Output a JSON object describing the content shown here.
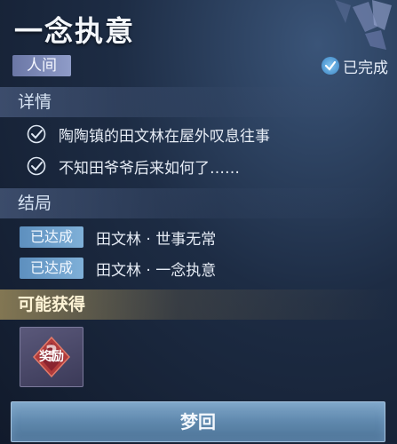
{
  "header": {
    "title": "一念执意",
    "tag": "人间",
    "status": "已完成"
  },
  "details": {
    "heading": "详情",
    "items": [
      "陶陶镇的田文林在屋外叹息往事",
      "不知田爷爷后来如何了……"
    ]
  },
  "endings": {
    "heading": "结局",
    "rows": [
      {
        "badge": "已达成",
        "label": "田文林 · 世事无常"
      },
      {
        "badge": "已达成",
        "label": "田文林 · 一念执意"
      }
    ]
  },
  "rewards": {
    "heading": "可能获得",
    "item_label": "奖励",
    "item_mark": "?"
  },
  "action": {
    "button_label": "梦回"
  },
  "colors": {
    "accent": "#5d8fbe",
    "gold": "#dcbe6e",
    "background": "#1d2c44"
  }
}
